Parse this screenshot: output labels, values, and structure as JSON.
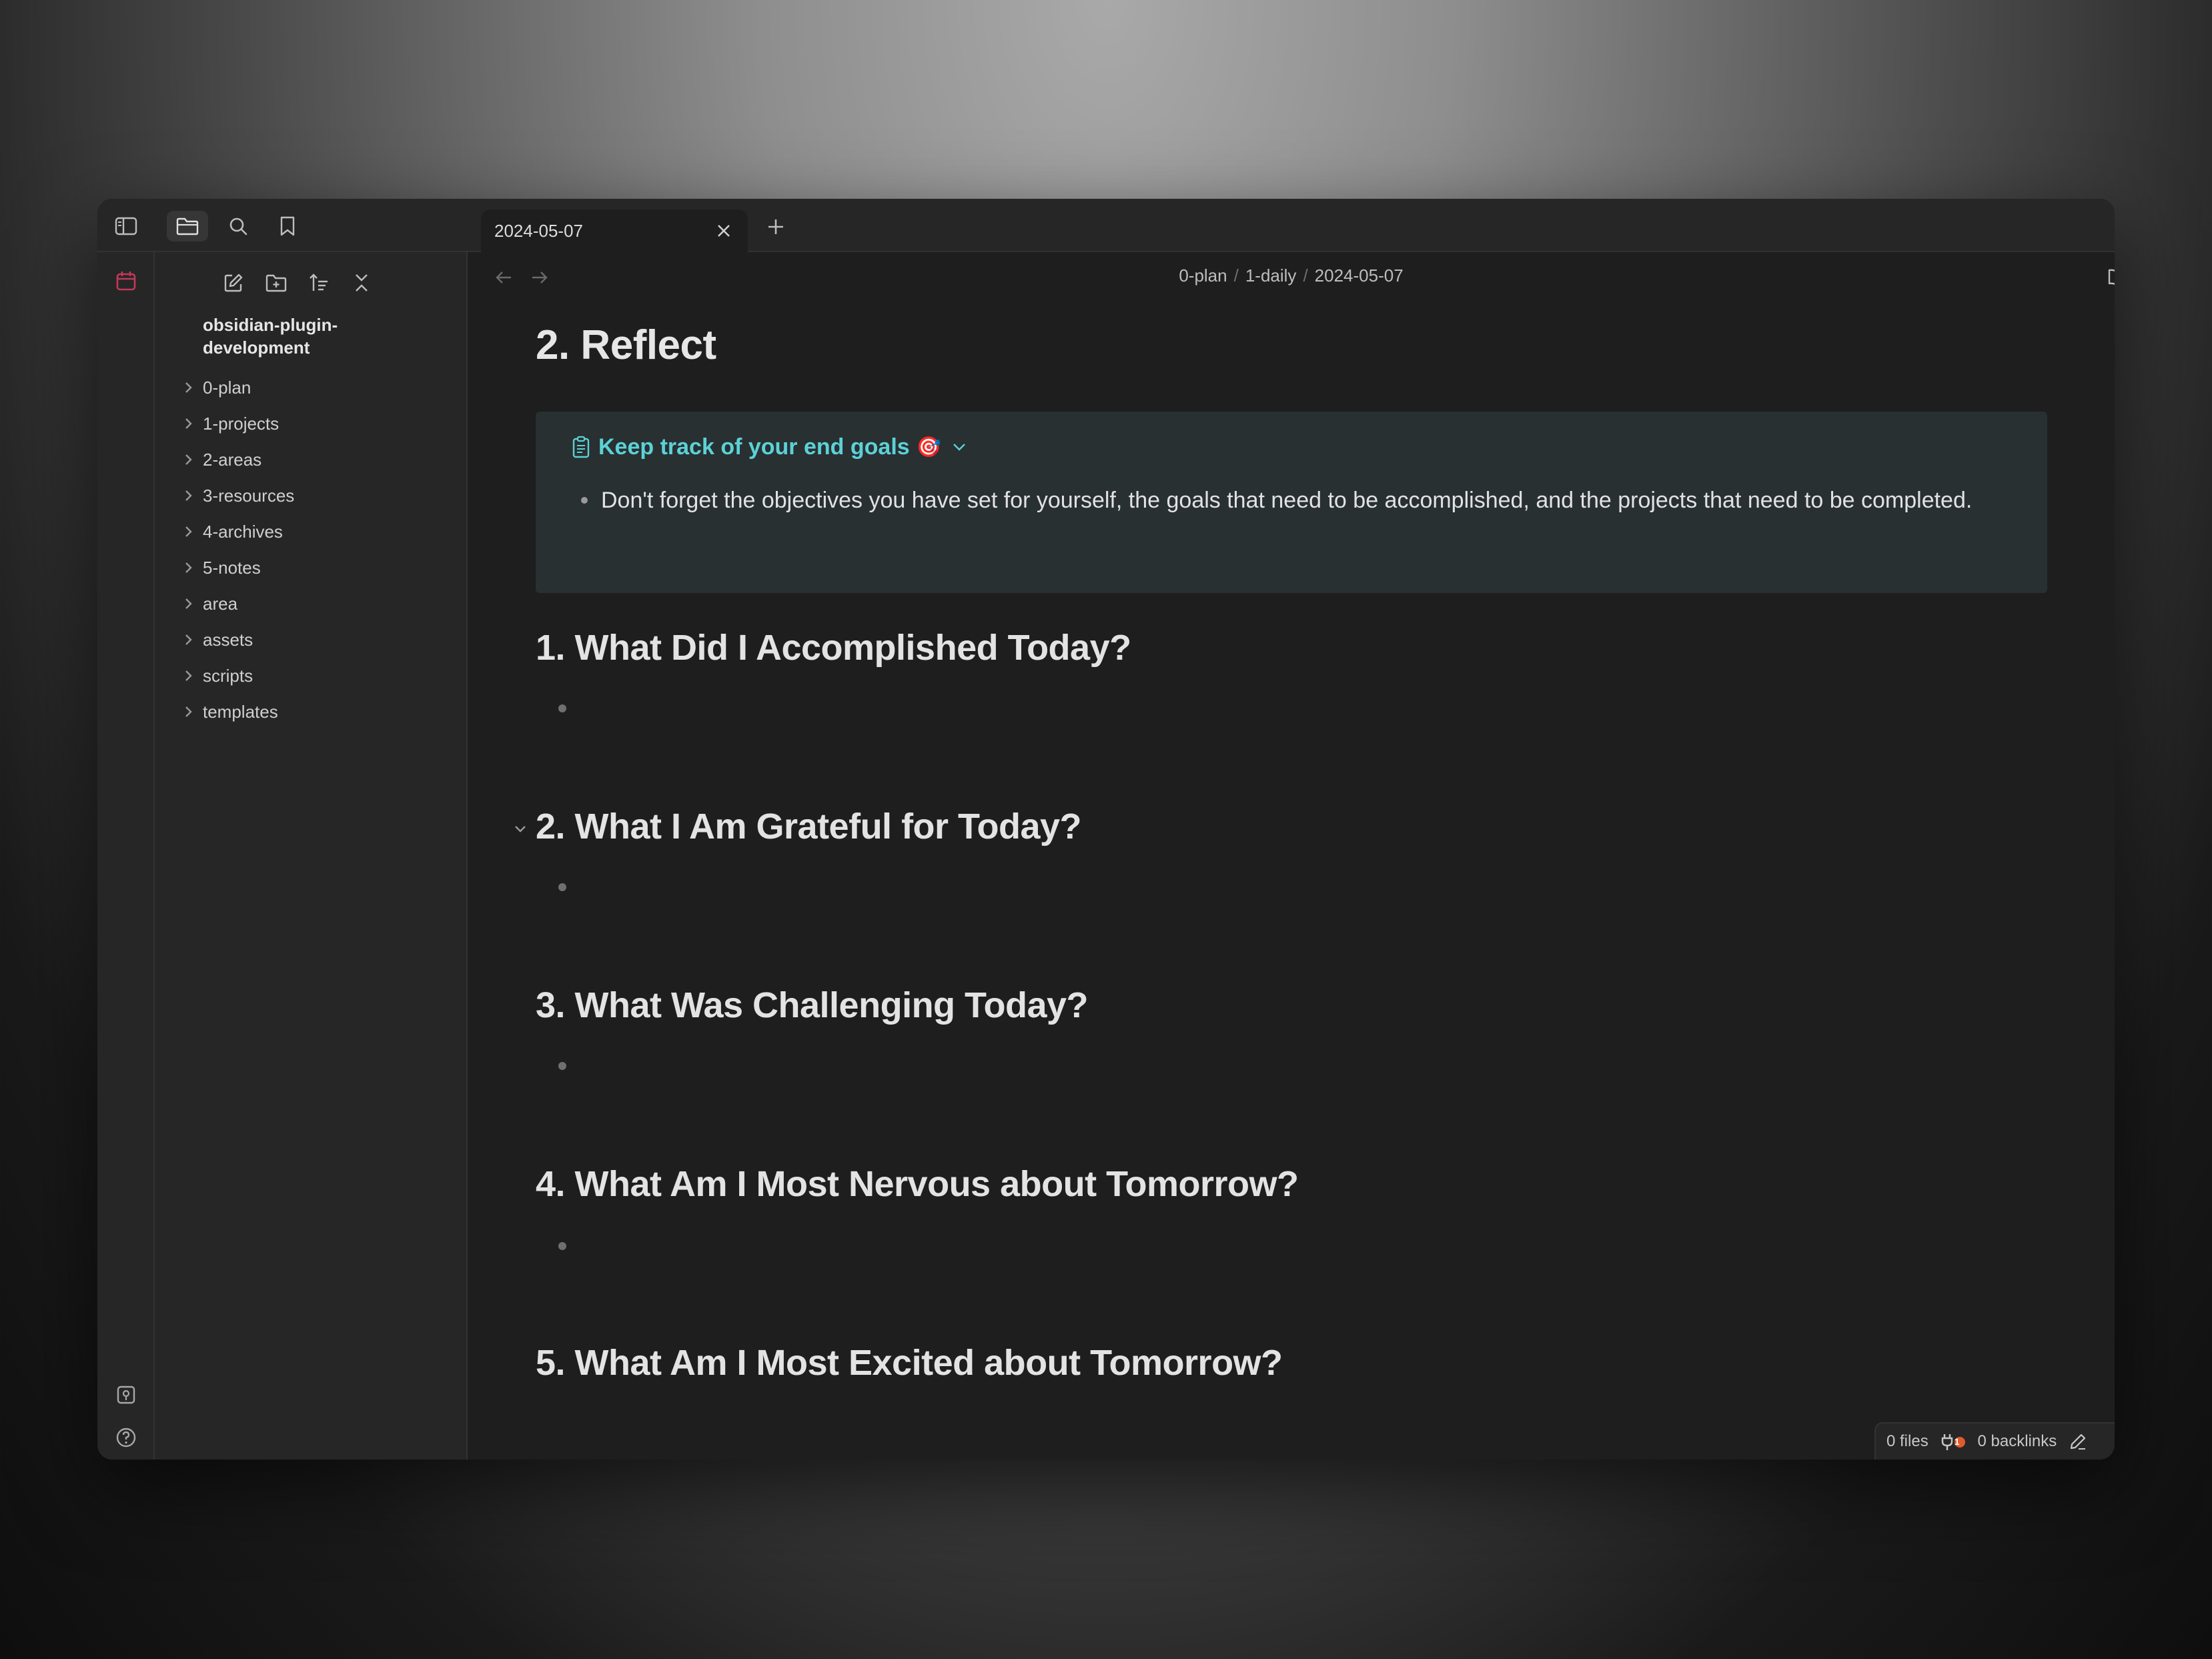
{
  "tab": {
    "title": "2024-05-07"
  },
  "breadcrumb": {
    "parts": [
      "0-plan",
      "1-daily",
      "2024-05-07"
    ]
  },
  "sidebar": {
    "vault_name": "obsidian-plugin-development",
    "folders": [
      "0-plan",
      "1-projects",
      "2-areas",
      "3-resources",
      "4-archives",
      "5-notes",
      "area",
      "assets",
      "scripts",
      "templates"
    ]
  },
  "note": {
    "title": "2. Reflect",
    "callout": {
      "title": "Keep track of your end goals",
      "emoji": "🎯",
      "text": "Don't forget the objectives you have set for yourself, the goals that need to be accomplished, and the projects that need to be completed."
    },
    "headings": [
      "1. What Did I Accomplished Today?",
      "2. What I Am Grateful for Today?",
      "3. What Was Challenging Today?",
      "4. What Am I Most Nervous about Tomorrow?",
      "5. What Am I Most Excited about Tomorrow?"
    ]
  },
  "status": {
    "files": "0 files",
    "badge": "1",
    "backlinks": "0 backlinks"
  },
  "colors": {
    "accent_callout": "#5cd1d6",
    "calendar_icon": "#c2385a",
    "badge": "#e25a2c"
  },
  "icons": {
    "top": [
      "sidebar-toggle-icon",
      "folder-icon",
      "search-icon",
      "bookmark-icon"
    ],
    "tools": [
      "new-note-icon",
      "new-folder-icon",
      "sort-icon",
      "collapse-all-icon"
    ],
    "ribbon": [
      "calendar-icon",
      "vault-switch-icon",
      "help-icon",
      "settings-icon"
    ]
  }
}
